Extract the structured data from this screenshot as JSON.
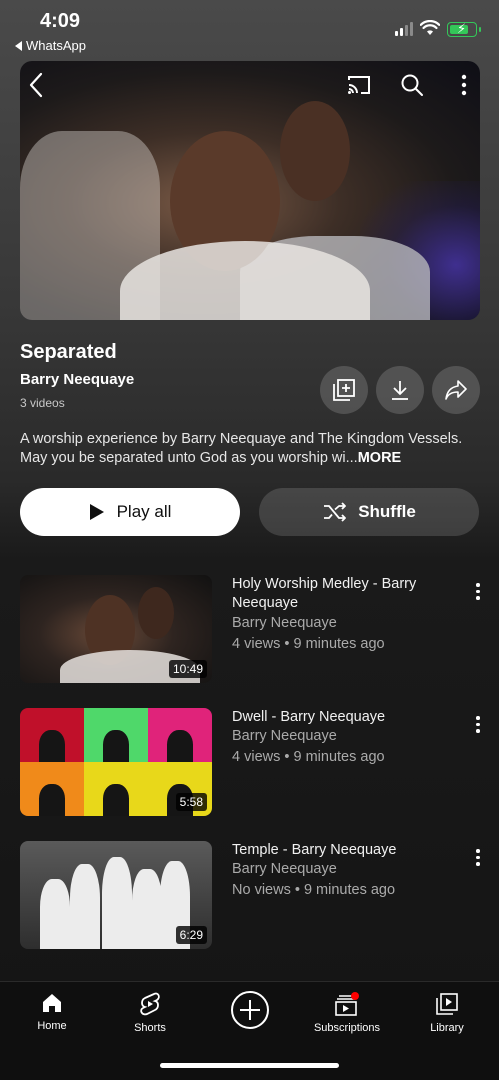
{
  "status_bar": {
    "time": "4:09",
    "back_app": "WhatsApp"
  },
  "hero": {
    "icons": [
      "back-arrow-icon",
      "cast-icon",
      "search-icon",
      "more-vert-icon"
    ]
  },
  "playlist": {
    "title": "Separated",
    "owner": "Barry Neequaye",
    "count": "3 videos",
    "description": "A worship experience by Barry Neequaye and The Kingdom Vessels. May you be separated unto God as you worship wi...",
    "more_label": "MORE",
    "actions": [
      "add-to-playlist-icon",
      "download-icon",
      "share-icon"
    ]
  },
  "buttons": {
    "play_all": "Play all",
    "shuffle": "Shuffle"
  },
  "videos": [
    {
      "title": "Holy Worship Medley - Barry Neequaye",
      "channel": "Barry Neequaye",
      "meta": "4 views • 9 minutes ago",
      "duration": "10:49"
    },
    {
      "title": "Dwell - Barry Neequaye",
      "channel": "Barry Neequaye",
      "meta": "4 views • 9 minutes ago",
      "duration": "5:58"
    },
    {
      "title": "Temple - Barry Neequaye",
      "channel": "Barry Neequaye",
      "meta": "No views • 9 minutes ago",
      "duration": "6:29"
    }
  ],
  "nav": {
    "home": "Home",
    "shorts": "Shorts",
    "subscriptions": "Subscriptions",
    "library": "Library"
  },
  "colors": {
    "battery": "#34c759",
    "notification_dot": "#ff0000",
    "nav_bg": "#0f0f0f"
  }
}
